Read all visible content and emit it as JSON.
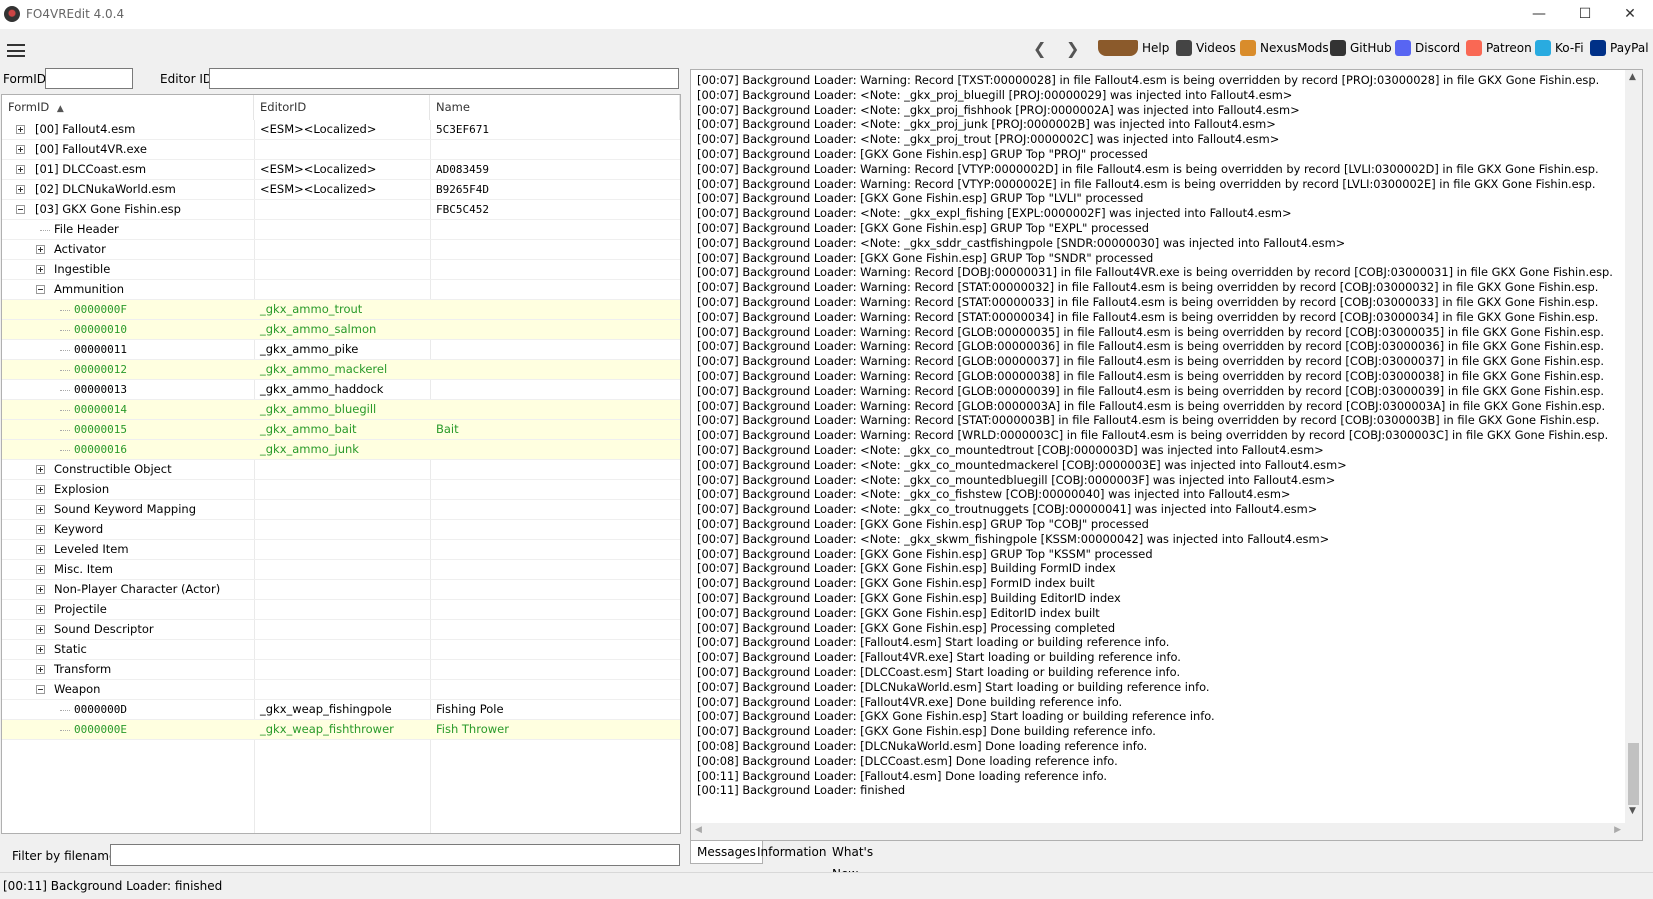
{
  "window": {
    "title": "FO4VREdit 4.0.4"
  },
  "toolbar": {
    "items": [
      {
        "label": "Help",
        "icon": "book-icon",
        "color": "#8b5a2b"
      },
      {
        "label": "Videos",
        "icon": "videos-icon",
        "color": "#444444"
      },
      {
        "label": "NexusMods",
        "icon": "nexusmods-icon",
        "color": "#d98c2b"
      },
      {
        "label": "GitHub",
        "icon": "github-icon",
        "color": "#333333"
      },
      {
        "label": "Discord",
        "icon": "discord-icon",
        "color": "#5865f2"
      },
      {
        "label": "Patreon",
        "icon": "patreon-icon",
        "color": "#f96854"
      },
      {
        "label": "Ko-Fi",
        "icon": "kofi-icon",
        "color": "#29abe0"
      },
      {
        "label": "PayPal",
        "icon": "paypal-icon",
        "color": "#003087"
      }
    ]
  },
  "search": {
    "formid_label": "FormID",
    "editorid_label": "Editor ID",
    "formid_value": "",
    "editorid_value": ""
  },
  "tree": {
    "columns": [
      "FormID",
      "EditorID",
      "Name"
    ],
    "rows": [
      {
        "level": 0,
        "exp": "plus",
        "formid": "[00] Fallout4.esm",
        "editorid": "<ESM><Localized>",
        "name": "5C3EF671",
        "hl": false,
        "green": false
      },
      {
        "level": 0,
        "exp": "plus",
        "formid": "[00] Fallout4VR.exe",
        "editorid": "",
        "name": "",
        "hl": false,
        "green": false
      },
      {
        "level": 0,
        "exp": "plus",
        "formid": "[01] DLCCoast.esm",
        "editorid": "<ESM><Localized>",
        "name": "AD083459",
        "hl": false,
        "green": false
      },
      {
        "level": 0,
        "exp": "plus",
        "formid": "[02] DLCNukaWorld.esm",
        "editorid": "<ESM><Localized>",
        "name": "B9265F4D",
        "hl": false,
        "green": false
      },
      {
        "level": 0,
        "exp": "minus",
        "formid": "[03] GKX Gone Fishin.esp",
        "editorid": "",
        "name": "FBC5C452",
        "hl": false,
        "green": false
      },
      {
        "level": 1,
        "exp": "none",
        "formid": "File Header",
        "editorid": "",
        "name": "",
        "hl": false,
        "green": false
      },
      {
        "level": 1,
        "exp": "plus",
        "formid": "Activator",
        "editorid": "",
        "name": "",
        "hl": false,
        "green": false
      },
      {
        "level": 1,
        "exp": "plus",
        "formid": "Ingestible",
        "editorid": "",
        "name": "",
        "hl": false,
        "green": false
      },
      {
        "level": 1,
        "exp": "minus",
        "formid": "Ammunition",
        "editorid": "",
        "name": "",
        "hl": false,
        "green": false
      },
      {
        "level": 2,
        "exp": "none",
        "formid": "0000000F",
        "editorid": "_gkx_ammo_trout",
        "name": "",
        "hl": true,
        "green": true
      },
      {
        "level": 2,
        "exp": "none",
        "formid": "00000010",
        "editorid": "_gkx_ammo_salmon",
        "name": "",
        "hl": true,
        "green": true
      },
      {
        "level": 2,
        "exp": "none",
        "formid": "00000011",
        "editorid": "_gkx_ammo_pike",
        "name": "",
        "hl": false,
        "green": false
      },
      {
        "level": 2,
        "exp": "none",
        "formid": "00000012",
        "editorid": "_gkx_ammo_mackerel",
        "name": "",
        "hl": true,
        "green": true
      },
      {
        "level": 2,
        "exp": "none",
        "formid": "00000013",
        "editorid": "_gkx_ammo_haddock",
        "name": "",
        "hl": false,
        "green": false
      },
      {
        "level": 2,
        "exp": "none",
        "formid": "00000014",
        "editorid": "_gkx_ammo_bluegill",
        "name": "",
        "hl": true,
        "green": true
      },
      {
        "level": 2,
        "exp": "none",
        "formid": "00000015",
        "editorid": "_gkx_ammo_bait",
        "name": "Bait",
        "hl": true,
        "green": true
      },
      {
        "level": 2,
        "exp": "none",
        "formid": "00000016",
        "editorid": "_gkx_ammo_junk",
        "name": "",
        "hl": true,
        "green": true
      },
      {
        "level": 1,
        "exp": "plus",
        "formid": "Constructible Object",
        "editorid": "",
        "name": "",
        "hl": false,
        "green": false
      },
      {
        "level": 1,
        "exp": "plus",
        "formid": "Explosion",
        "editorid": "",
        "name": "",
        "hl": false,
        "green": false
      },
      {
        "level": 1,
        "exp": "plus",
        "formid": "Sound Keyword Mapping",
        "editorid": "",
        "name": "",
        "hl": false,
        "green": false
      },
      {
        "level": 1,
        "exp": "plus",
        "formid": "Keyword",
        "editorid": "",
        "name": "",
        "hl": false,
        "green": false
      },
      {
        "level": 1,
        "exp": "plus",
        "formid": "Leveled Item",
        "editorid": "",
        "name": "",
        "hl": false,
        "green": false
      },
      {
        "level": 1,
        "exp": "plus",
        "formid": "Misc. Item",
        "editorid": "",
        "name": "",
        "hl": false,
        "green": false
      },
      {
        "level": 1,
        "exp": "plus",
        "formid": "Non-Player Character (Actor)",
        "editorid": "",
        "name": "",
        "hl": false,
        "green": false
      },
      {
        "level": 1,
        "exp": "plus",
        "formid": "Projectile",
        "editorid": "",
        "name": "",
        "hl": false,
        "green": false
      },
      {
        "level": 1,
        "exp": "plus",
        "formid": "Sound Descriptor",
        "editorid": "",
        "name": "",
        "hl": false,
        "green": false
      },
      {
        "level": 1,
        "exp": "plus",
        "formid": "Static",
        "editorid": "",
        "name": "",
        "hl": false,
        "green": false
      },
      {
        "level": 1,
        "exp": "plus",
        "formid": "Transform",
        "editorid": "",
        "name": "",
        "hl": false,
        "green": false
      },
      {
        "level": 1,
        "exp": "minus",
        "formid": "Weapon",
        "editorid": "",
        "name": "",
        "hl": false,
        "green": false
      },
      {
        "level": 2,
        "exp": "none",
        "formid": "0000000D",
        "editorid": "_gkx_weap_fishingpole",
        "name": "Fishing Pole",
        "hl": false,
        "green": false
      },
      {
        "level": 2,
        "exp": "none",
        "formid": "0000000E",
        "editorid": "_gkx_weap_fishthrower",
        "name": "Fish Thrower",
        "hl": true,
        "green": true
      }
    ]
  },
  "filter": {
    "label": "Filter by filename:",
    "value": ""
  },
  "log": {
    "lines": [
      "[00:07] Background Loader: Warning: Record [TXST:00000028] in file Fallout4.esm is being overridden by record [PROJ:03000028] in file GKX Gone Fishin.esp.",
      "[00:07] Background Loader: <Note: _gkx_proj_bluegill [PROJ:00000029] was injected into Fallout4.esm>",
      "[00:07] Background Loader: <Note: _gkx_proj_fishhook [PROJ:0000002A] was injected into Fallout4.esm>",
      "[00:07] Background Loader: <Note: _gkx_proj_junk [PROJ:0000002B] was injected into Fallout4.esm>",
      "[00:07] Background Loader: <Note: _gkx_proj_trout [PROJ:0000002C] was injected into Fallout4.esm>",
      "[00:07] Background Loader: [GKX Gone Fishin.esp] GRUP Top \"PROJ\" processed",
      "[00:07] Background Loader: Warning: Record [VTYP:0000002D] in file Fallout4.esm is being overridden by record [LVLI:0300002D] in file GKX Gone Fishin.esp.",
      "[00:07] Background Loader: Warning: Record [VTYP:0000002E] in file Fallout4.esm is being overridden by record [LVLI:0300002E] in file GKX Gone Fishin.esp.",
      "[00:07] Background Loader: [GKX Gone Fishin.esp] GRUP Top \"LVLI\" processed",
      "[00:07] Background Loader: <Note: _gkx_expl_fishing [EXPL:0000002F] was injected into Fallout4.esm>",
      "[00:07] Background Loader: [GKX Gone Fishin.esp] GRUP Top \"EXPL\" processed",
      "[00:07] Background Loader: <Note: _gkx_sddr_castfishingpole [SNDR:00000030] was injected into Fallout4.esm>",
      "[00:07] Background Loader: [GKX Gone Fishin.esp] GRUP Top \"SNDR\" processed",
      "[00:07] Background Loader: Warning: Record [DOBJ:00000031] in file Fallout4VR.exe is being overridden by record [COBJ:03000031] in file GKX Gone Fishin.esp.",
      "[00:07] Background Loader: Warning: Record [STAT:00000032] in file Fallout4.esm is being overridden by record [COBJ:03000032] in file GKX Gone Fishin.esp.",
      "[00:07] Background Loader: Warning: Record [STAT:00000033] in file Fallout4.esm is being overridden by record [COBJ:03000033] in file GKX Gone Fishin.esp.",
      "[00:07] Background Loader: Warning: Record [STAT:00000034] in file Fallout4.esm is being overridden by record [COBJ:03000034] in file GKX Gone Fishin.esp.",
      "[00:07] Background Loader: Warning: Record [GLOB:00000035] in file Fallout4.esm is being overridden by record [COBJ:03000035] in file GKX Gone Fishin.esp.",
      "[00:07] Background Loader: Warning: Record [GLOB:00000036] in file Fallout4.esm is being overridden by record [COBJ:03000036] in file GKX Gone Fishin.esp.",
      "[00:07] Background Loader: Warning: Record [GLOB:00000037] in file Fallout4.esm is being overridden by record [COBJ:03000037] in file GKX Gone Fishin.esp.",
      "[00:07] Background Loader: Warning: Record [GLOB:00000038] in file Fallout4.esm is being overridden by record [COBJ:03000038] in file GKX Gone Fishin.esp.",
      "[00:07] Background Loader: Warning: Record [GLOB:00000039] in file Fallout4.esm is being overridden by record [COBJ:03000039] in file GKX Gone Fishin.esp.",
      "[00:07] Background Loader: Warning: Record [GLOB:0000003A] in file Fallout4.esm is being overridden by record [COBJ:0300003A] in file GKX Gone Fishin.esp.",
      "[00:07] Background Loader: Warning: Record [STAT:0000003B] in file Fallout4.esm is being overridden by record [COBJ:0300003B] in file GKX Gone Fishin.esp.",
      "[00:07] Background Loader: Warning: Record [WRLD:0000003C] in file Fallout4.esm is being overridden by record [COBJ:0300003C] in file GKX Gone Fishin.esp.",
      "[00:07] Background Loader: <Note: _gkx_co_mountedtrout [COBJ:0000003D] was injected into Fallout4.esm>",
      "[00:07] Background Loader: <Note: _gkx_co_mountedmackerel [COBJ:0000003E] was injected into Fallout4.esm>",
      "[00:07] Background Loader: <Note: _gkx_co_mountedbluegill [COBJ:0000003F] was injected into Fallout4.esm>",
      "[00:07] Background Loader: <Note: _gkx_co_fishstew [COBJ:00000040] was injected into Fallout4.esm>",
      "[00:07] Background Loader: <Note: _gkx_co_troutnuggets [COBJ:00000041] was injected into Fallout4.esm>",
      "[00:07] Background Loader: [GKX Gone Fishin.esp] GRUP Top \"COBJ\" processed",
      "[00:07] Background Loader: <Note: _gkx_skwm_fishingpole [KSSM:00000042] was injected into Fallout4.esm>",
      "[00:07] Background Loader: [GKX Gone Fishin.esp] GRUP Top \"KSSM\" processed",
      "[00:07] Background Loader: [GKX Gone Fishin.esp] Building FormID index",
      "[00:07] Background Loader: [GKX Gone Fishin.esp] FormID index built",
      "[00:07] Background Loader: [GKX Gone Fishin.esp] Building EditorID index",
      "[00:07] Background Loader: [GKX Gone Fishin.esp] EditorID index built",
      "[00:07] Background Loader: [GKX Gone Fishin.esp] Processing completed",
      "[00:07] Background Loader: [Fallout4.esm] Start loading or building reference info.",
      "[00:07] Background Loader: [Fallout4VR.exe] Start loading or building reference info.",
      "[00:07] Background Loader: [DLCCoast.esm] Start loading or building reference info.",
      "[00:07] Background Loader: [DLCNukaWorld.esm] Start loading or building reference info.",
      "[00:07] Background Loader: [Fallout4VR.exe] Done building reference info.",
      "[00:07] Background Loader: [GKX Gone Fishin.esp] Start loading or building reference info.",
      "[00:07] Background Loader: [GKX Gone Fishin.esp] Done building reference info.",
      "[00:08] Background Loader: [DLCNukaWorld.esm] Done loading reference info.",
      "[00:08] Background Loader: [DLCCoast.esm] Done loading reference info.",
      "[00:11] Background Loader: [Fallout4.esm] Done loading reference info.",
      "[00:11] Background Loader: finished"
    ]
  },
  "tabs": [
    "Messages",
    "Information",
    "What's New"
  ],
  "status": {
    "text": "[00:11] Background Loader: finished"
  }
}
